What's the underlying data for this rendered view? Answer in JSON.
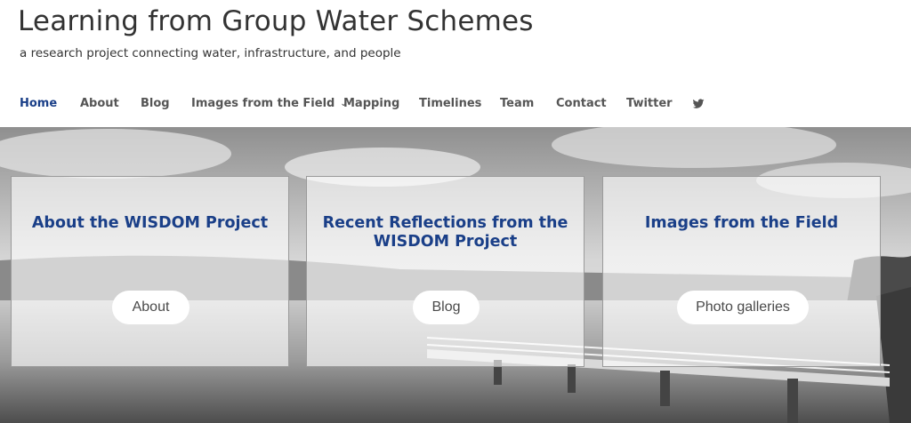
{
  "header": {
    "title": "Learning from Group Water Schemes",
    "tagline": "a research project connecting water, infrastructure, and people"
  },
  "nav": {
    "items": [
      {
        "label": "Home",
        "active": true
      },
      {
        "label": "About"
      },
      {
        "label": "Blog"
      },
      {
        "label": "Images from the Field",
        "has_dropdown": true,
        "dropdown_icon": "chevron-down-icon"
      },
      {
        "label": "Mapping"
      },
      {
        "label": "Timelines"
      },
      {
        "label": "Team"
      },
      {
        "label": "Contact"
      },
      {
        "label": "Twitter"
      }
    ],
    "social_icon": "twitter-icon"
  },
  "hero": {
    "background": "grayscale photo of a lake with a pier and cloudy sky",
    "cards": [
      {
        "title": "About the WISDOM Project",
        "button": "About"
      },
      {
        "title": "Recent Reflections from the WISDOM Project",
        "button": "Blog"
      },
      {
        "title": "Images from the Field",
        "button": "Photo galleries"
      }
    ]
  },
  "colors": {
    "accent": "#1a3f88",
    "nav_text": "#555555",
    "title_text": "#333333"
  }
}
